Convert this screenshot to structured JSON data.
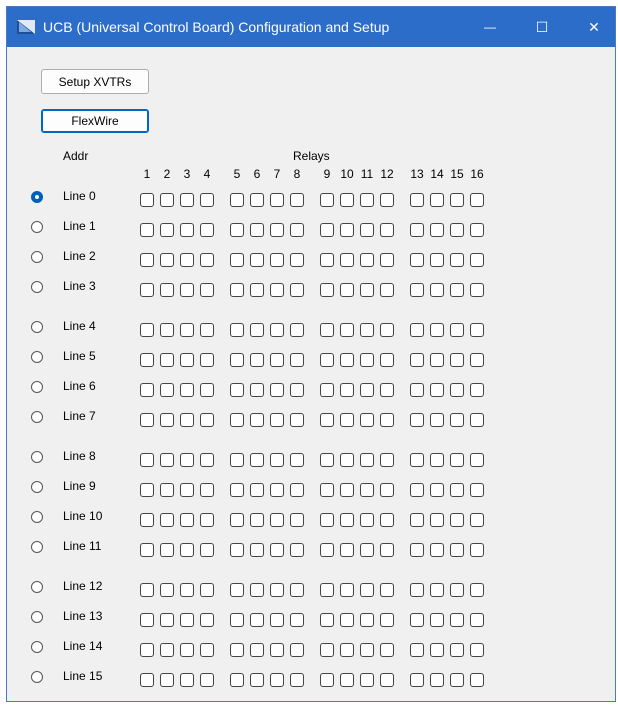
{
  "window": {
    "title": "UCB (Universal Control Board) Configuration and Setup",
    "minimize_glyph": "—",
    "maximize_glyph": "☐",
    "close_glyph": "✕"
  },
  "buttons": {
    "setup_xvtrs": "Setup XVTRs",
    "flexwire": "FlexWire"
  },
  "headers": {
    "addr": "Addr",
    "relays": "Relays"
  },
  "relay_numbers": [
    "1",
    "2",
    "3",
    "4",
    "5",
    "6",
    "7",
    "8",
    "9",
    "10",
    "11",
    "12",
    "13",
    "14",
    "15",
    "16"
  ],
  "lines": [
    {
      "label": "Line 0",
      "selected": true
    },
    {
      "label": "Line 1",
      "selected": false
    },
    {
      "label": "Line 2",
      "selected": false
    },
    {
      "label": "Line 3",
      "selected": false
    },
    {
      "label": "Line 4",
      "selected": false
    },
    {
      "label": "Line 5",
      "selected": false
    },
    {
      "label": "Line 6",
      "selected": false
    },
    {
      "label": "Line 7",
      "selected": false
    },
    {
      "label": "Line 8",
      "selected": false
    },
    {
      "label": "Line 9",
      "selected": false
    },
    {
      "label": "Line 10",
      "selected": false
    },
    {
      "label": "Line 11",
      "selected": false
    },
    {
      "label": "Line 12",
      "selected": false
    },
    {
      "label": "Line 13",
      "selected": false
    },
    {
      "label": "Line 14",
      "selected": false
    },
    {
      "label": "Line 15",
      "selected": false
    }
  ],
  "colors": {
    "titlebar": "#2b6dc9",
    "radio_selected": "#005fb8"
  }
}
